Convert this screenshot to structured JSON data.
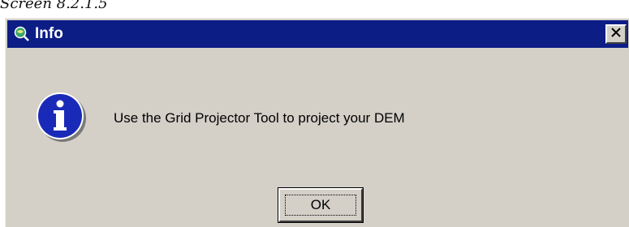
{
  "caption": "Screen 8.2.1.5",
  "dialog": {
    "title": "Info",
    "message": "Use the Grid Projector Tool to project your DEM",
    "ok_label": "OK",
    "title_icon": "magnifier-globe-icon",
    "message_icon": "info-icon",
    "close_icon": "close-icon"
  },
  "colors": {
    "titlebar": "#0c1d86",
    "window_face": "#d4d0c8",
    "info_circle": "#1a2ab8"
  }
}
